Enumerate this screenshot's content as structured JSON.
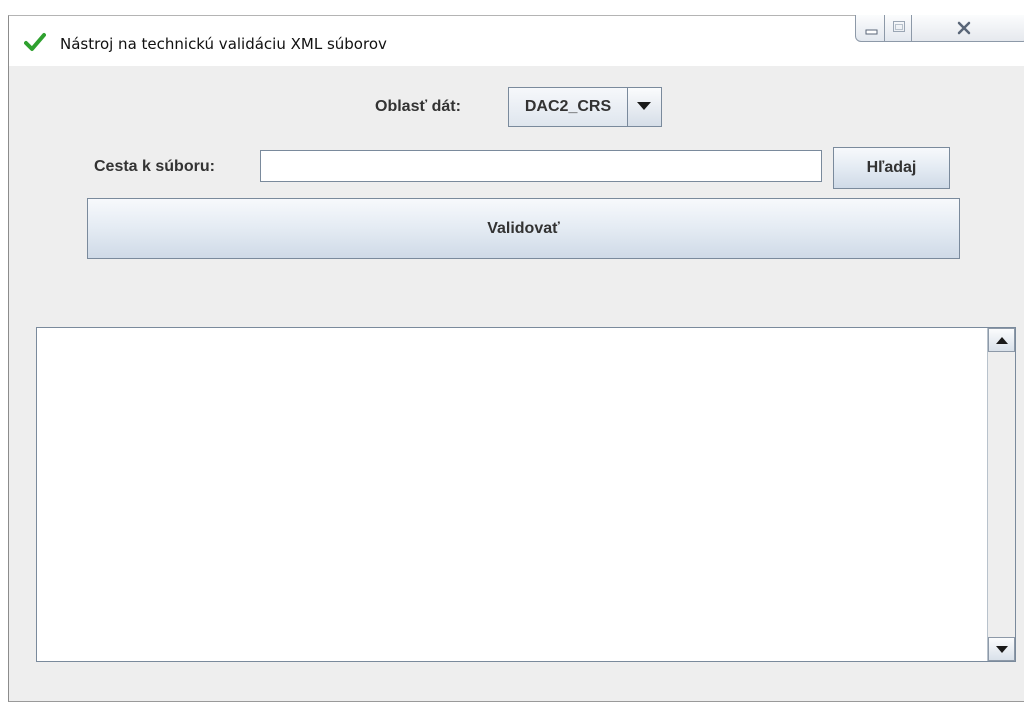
{
  "window": {
    "title": "Nástroj na technickú validáciu XML súborov",
    "title_icon": "checkmark-icon",
    "controls": [
      "minimize-icon",
      "maximize-icon",
      "close-icon"
    ]
  },
  "form": {
    "area_label": "Oblasť dát:",
    "area_value": "DAC2_CRS",
    "path_label": "Cesta k súboru:",
    "path_value": "",
    "search_button": "Hľadaj",
    "validate_button": "Validovať"
  },
  "output": {
    "text": ""
  },
  "colors": {
    "check_green": "#2fa12f",
    "window_bg": "#eeeeee",
    "border": "#7a8a9c"
  }
}
